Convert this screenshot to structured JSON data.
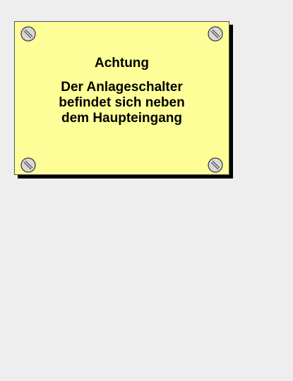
{
  "sign": {
    "title": "Achtung",
    "lines": [
      "Der Anlageschalter",
      "befindet sich neben",
      "dem Haupteingang"
    ]
  },
  "colors": {
    "background": "#eeeeee",
    "sign_fill": "#ffff99",
    "shadow": "#000000",
    "screw_fill": "#d8d8d8",
    "text": "#000000"
  },
  "icons": {
    "screws": [
      "screw-icon",
      "screw-icon",
      "screw-icon",
      "screw-icon"
    ]
  }
}
